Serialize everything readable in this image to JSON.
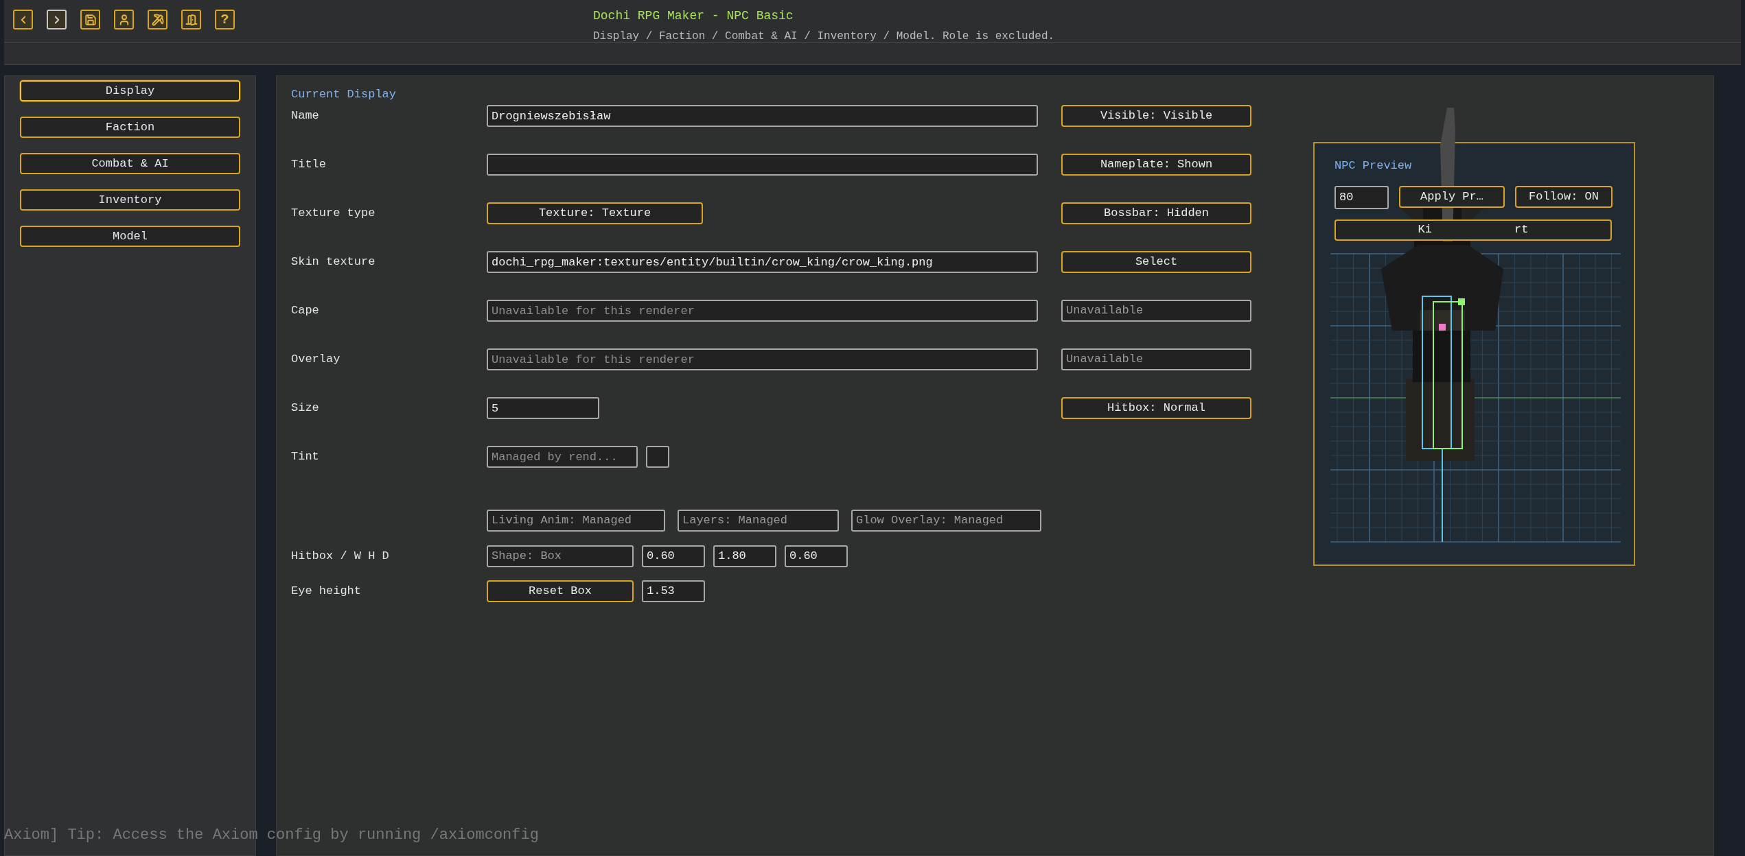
{
  "toolbar": [
    {
      "kind": "back",
      "enabled": true
    },
    {
      "kind": "forward",
      "enabled": false
    },
    {
      "kind": "save",
      "enabled": true
    },
    {
      "kind": "person",
      "enabled": true
    },
    {
      "kind": "pickaxe",
      "enabled": true
    },
    {
      "kind": "door",
      "enabled": true
    },
    {
      "kind": "help",
      "enabled": true,
      "label": "?"
    }
  ],
  "header": {
    "title": "Dochi RPG Maker - NPC Basic",
    "subtitle": "Display / Faction / Combat & AI / Inventory / Model. Role is excluded."
  },
  "sidebar": {
    "items": [
      {
        "label": "Display",
        "selected": true
      },
      {
        "label": "Faction",
        "selected": false
      },
      {
        "label": "Combat & AI",
        "selected": false
      },
      {
        "label": "Inventory",
        "selected": false
      },
      {
        "label": "Model",
        "selected": false
      }
    ]
  },
  "form": {
    "heading": "Current Display",
    "rows": [
      {
        "label": "Name",
        "field": {
          "kind": "text",
          "value": "Drogniewszebisław"
        },
        "side": {
          "kind": "toggle",
          "text": "Visible: Visible"
        }
      },
      {
        "label": "Title",
        "field": {
          "kind": "text"
        },
        "side": {
          "kind": "toggle",
          "text": "Nameplate: Shown"
        }
      },
      {
        "label": "Texture type",
        "field": {
          "kind": "select",
          "value": "Texture: Texture"
        },
        "side": {
          "kind": "toggle",
          "text": "Bossbar: Hidden"
        }
      },
      {
        "label": "Skin texture",
        "field": {
          "kind": "text",
          "value": "dochi_rpg_maker:textures/entity/builtin/crow_king/crow_king.png"
        },
        "side": {
          "kind": "toggle",
          "text": "Select"
        }
      },
      {
        "label": "Cape",
        "field": {
          "kind": "text",
          "placeholder": "Unavailable for this renderer"
        },
        "side": {
          "kind": "status",
          "text": "Unavailable"
        }
      },
      {
        "label": "Overlay",
        "field": {
          "kind": "text",
          "placeholder": "Unavailable for this renderer"
        },
        "side": {
          "kind": "status",
          "text": "Unavailable"
        }
      },
      {
        "label": "Size",
        "field": {
          "kind": "number",
          "value": "5"
        },
        "side": {
          "kind": "toggle",
          "text": "Hitbox: Normal"
        }
      },
      {
        "label": "Tint",
        "field": {
          "kind": "tint",
          "placeholder": "Managed by rend..."
        }
      }
    ],
    "flags": [
      "Living Anim: Managed",
      "Layers: Managed",
      "Glow Overlay: Managed"
    ],
    "hitbox": {
      "label": "Hitbox / W H D",
      "shape": "Shape: Box",
      "values": [
        "0.60",
        "1.80",
        "0.60"
      ]
    },
    "eye_height": {
      "label": "Eye height",
      "button": "Reset Box",
      "value": "1.53"
    }
  },
  "preview": {
    "title": "NPC Preview",
    "zoom": "80",
    "apply_button": "Apply Pr…",
    "follow_button": "Follow: ON",
    "wide_button_parts": [
      "Ki",
      "rt"
    ]
  },
  "chat_message": "Axiom] Tip: Access the Axiom config by running /axiomconfig"
}
